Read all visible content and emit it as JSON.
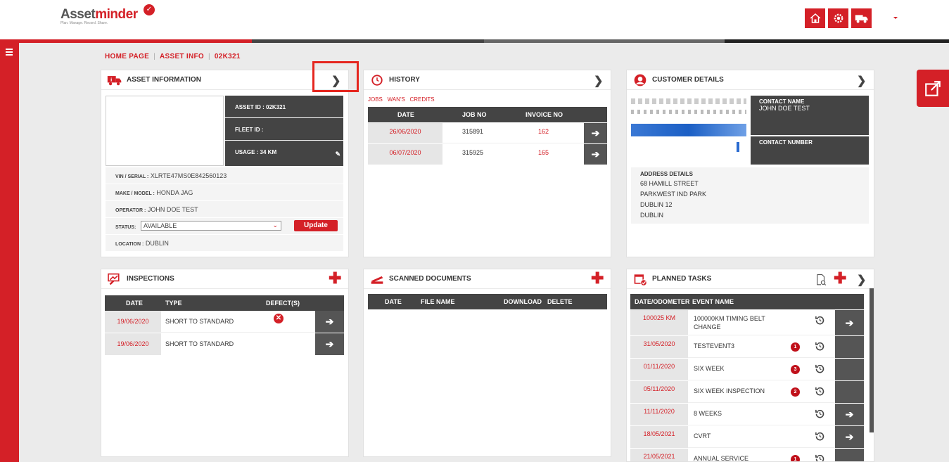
{
  "app": {
    "logo_part1": "Asset",
    "logo_part2": "minder",
    "tagline": "Plan. Manage. Record. Share.",
    "accent": "#d42027"
  },
  "header_icons": [
    "home-icon",
    "gear-icon",
    "truck-icon"
  ],
  "breadcrumb": {
    "home": "HOME PAGE",
    "asset_info": "ASSET INFO",
    "asset_id": "02K321"
  },
  "asset_info": {
    "title": "ASSET INFORMATION",
    "asset_id": "ASSET ID : 02K321",
    "fleet_id": "FLEET ID :",
    "usage": "USAGE : 34 KM",
    "vin_label": "VIN / SERIAL :",
    "vin_value": "XLRTE47MS0E842560123",
    "make_label": "MAKE / MODEL :",
    "make_value": "HONDA JAG",
    "operator_label": "OPERATOR :",
    "operator_value": "JOHN DOE TEST",
    "status_label": "STATUS:",
    "status_value": "AVAILABLE",
    "update_label": "Update",
    "location_label": "LOCATION :",
    "location_value": "DUBLIN"
  },
  "history": {
    "title": "HISTORY",
    "tabs": [
      "JOBS",
      "WAN'S",
      "CREDITS"
    ],
    "columns": [
      "DATE",
      "JOB NO",
      "INVOICE NO"
    ],
    "rows": [
      {
        "date": "26/06/2020",
        "job_no": "315891",
        "invoice_no": "162"
      },
      {
        "date": "06/07/2020",
        "job_no": "315925",
        "invoice_no": "165"
      }
    ]
  },
  "customer": {
    "title": "CUSTOMER DETAILS",
    "contact_name_label": "CONTACT NAME",
    "contact_name_value": "JOHN DOE TEST",
    "contact_number_label": "CONTACT NUMBER",
    "address_label": "ADDRESS DETAILS",
    "address_lines": [
      "68 HAMILL STREET",
      "PARKWEST IND PARK",
      "DUBLIN 12",
      "DUBLIN"
    ]
  },
  "inspections": {
    "title": "INSPECTIONS",
    "columns": [
      "DATE",
      "TYPE",
      "DEFECT(S)"
    ],
    "rows": [
      {
        "date": "19/06/2020",
        "type": "SHORT TO STANDARD",
        "defect": true
      },
      {
        "date": "19/06/2020",
        "type": "SHORT TO STANDARD",
        "defect": false
      }
    ]
  },
  "scanned": {
    "title": "SCANNED DOCUMENTS",
    "columns": [
      "DATE",
      "FILE NAME",
      "DOWNLOAD",
      "DELETE"
    ]
  },
  "planned": {
    "title": "PLANNED TASKS",
    "columns": [
      "DATE/ODOMETER",
      "EVENT NAME"
    ],
    "rows": [
      {
        "date": "100025 KM",
        "event": "100000KM TIMING BELT CHANGE",
        "badge": "",
        "arrow": true
      },
      {
        "date": "31/05/2020",
        "event": "TESTEVENT3",
        "badge": "1",
        "arrow": false
      },
      {
        "date": "01/11/2020",
        "event": "SIX WEEK",
        "badge": "3",
        "arrow": false
      },
      {
        "date": "05/11/2020",
        "event": "SIX WEEK INSPECTION",
        "badge": "2",
        "arrow": false
      },
      {
        "date": "11/11/2020",
        "event": "8 WEEKS",
        "badge": "",
        "arrow": true
      },
      {
        "date": "18/05/2021",
        "event": "CVRT",
        "badge": "",
        "arrow": true
      },
      {
        "date": "21/05/2021",
        "event": "ANNUAL SERVICE",
        "badge": "1",
        "arrow": false
      }
    ]
  }
}
